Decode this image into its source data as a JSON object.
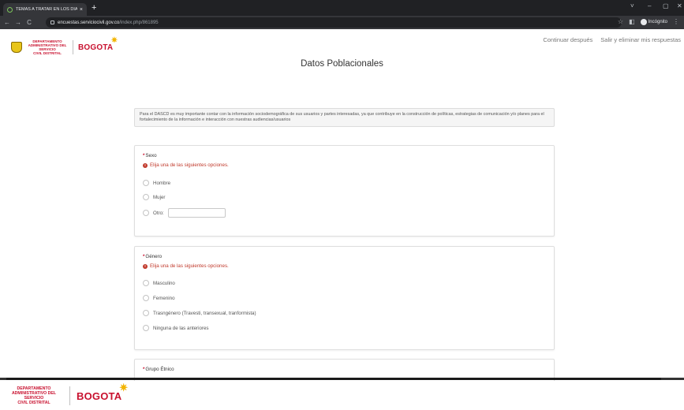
{
  "browser": {
    "tab_title": "TEMAS A TRATAR EN LOS DIÁLC",
    "tab_close": "×",
    "new_tab": "+",
    "url_host": "encuestas.serviciocivil.gov.co",
    "url_path": "/index.php/861895",
    "incognito_label": "Incógnito",
    "minimize": "–",
    "maximize": "▢",
    "close": "✕",
    "back": "←",
    "forward": "→",
    "reload": "C",
    "star": "☆",
    "sidebar": "◧",
    "menu": "⋮",
    "tab_menu": "˅"
  },
  "header": {
    "dept_line1": "DEPARTAMENTO",
    "dept_line2": "ADMINISTRATIVO DEL SERVICIO",
    "dept_line3": "CIVIL DISTRITAL",
    "bogota": "BOGOTA",
    "sun": "✷",
    "links": {
      "continue": "Continuar después",
      "exit": "Salir y eliminar mis respuestas"
    }
  },
  "page": {
    "title": "Datos Poblacionales",
    "info": "Para el DASCD es muy importante contar con la información sociodemográfica de sus usuarios y partes interesadas, ya que contribuye en la construcción de políticas, estrategias de comunicación y/o planes para el fortalecimiento de la información e interacción con nuestras audiencias/usuarios"
  },
  "questions": {
    "sexo": {
      "required_mark": "*",
      "title": "Sexo",
      "error": "Elija una de las siguientes opciones.",
      "options": [
        "Hombre",
        "Mujer",
        "Otro:"
      ]
    },
    "genero": {
      "required_mark": "*",
      "title": "Género",
      "error": "Elija una de las siguientes opciones.",
      "options": [
        "Masculino",
        "Femenino",
        "Trasngénero (Travesti, transexual, tranformista)",
        "Ninguna de las anteriores"
      ]
    },
    "etnico": {
      "required_mark": "*",
      "title": "Grupo Étnico"
    }
  },
  "colors": {
    "brand_red": "#c8102e",
    "error_red": "#c0392b",
    "chrome_dark": "#202124"
  }
}
